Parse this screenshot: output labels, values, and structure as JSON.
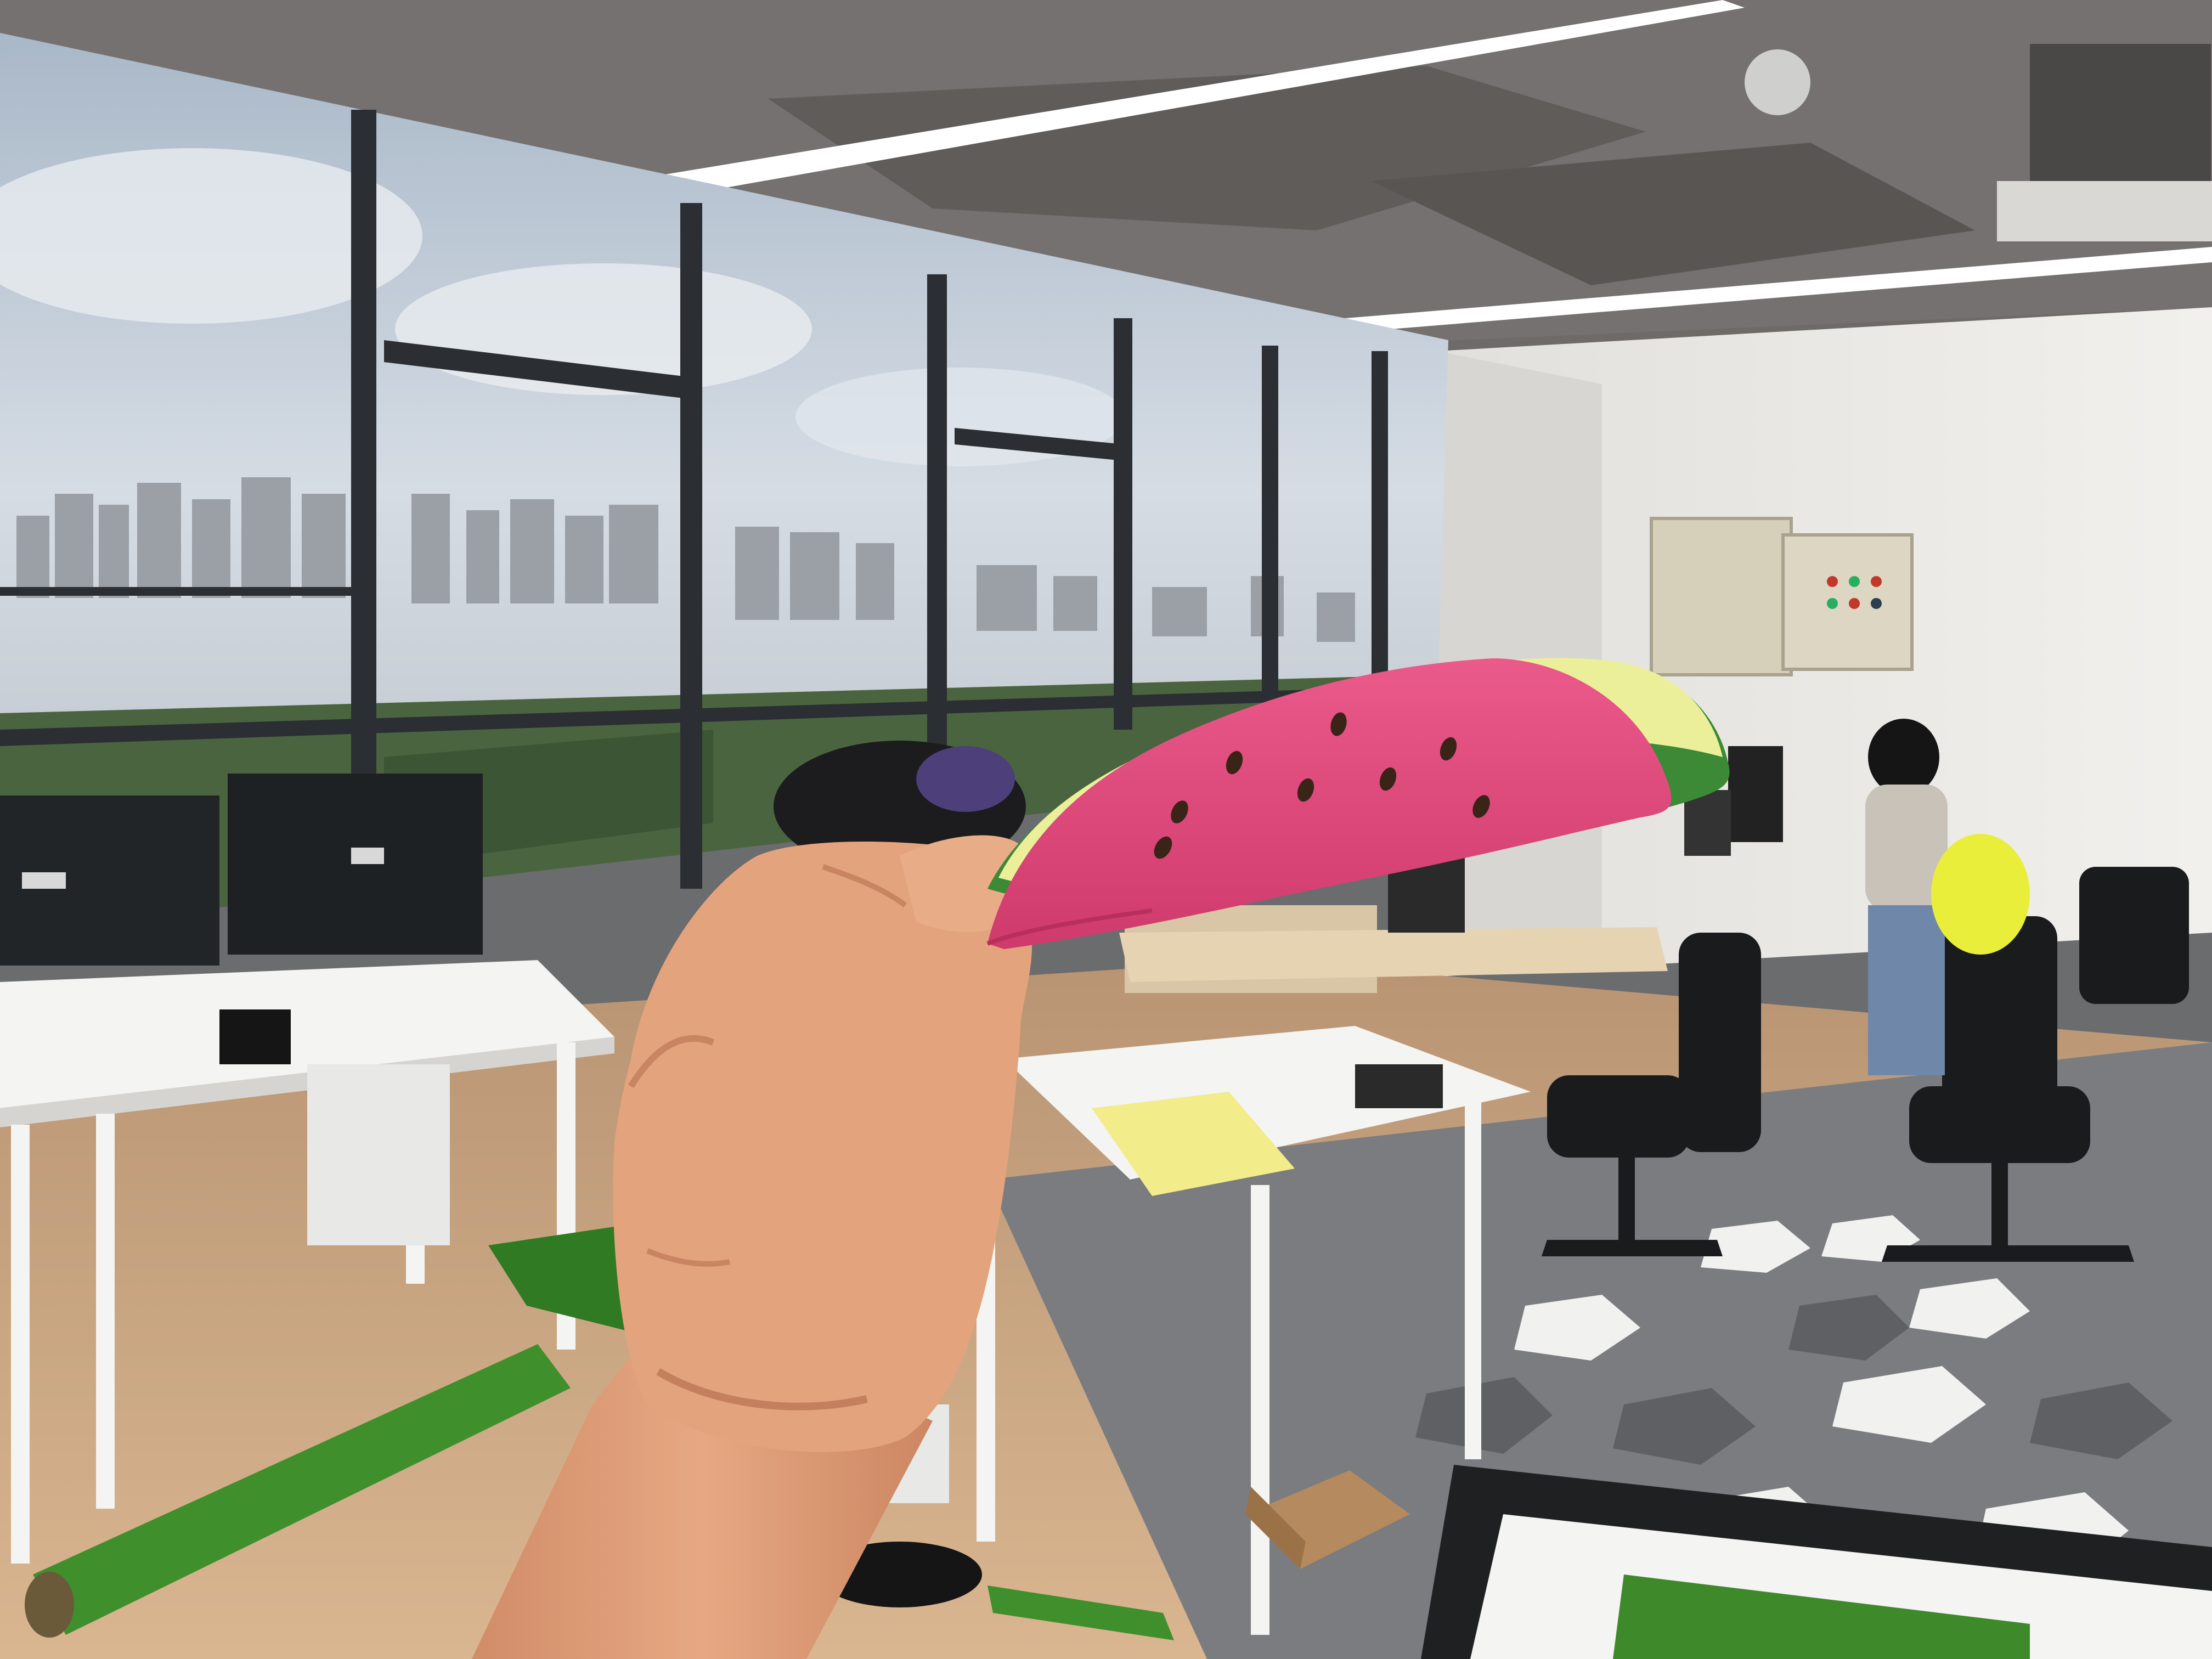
{
  "scene": {
    "subject": "watermelon-slice-plush",
    "colors": {
      "sky": "#c9d3de",
      "sky_cloud": "#e9edf1",
      "city": "#9ea3a8",
      "trees": "#3f5a3a",
      "ceiling": "#6a6766",
      "wall": "#ecebe8",
      "floor_wood": "#c7a27d",
      "hex_white": "#f1f1f0",
      "hex_grey": "#8e8f91",
      "hex_dark": "#5f6063",
      "frame": "#2c3034",
      "desk": "#f4f4f2",
      "turf": "#3f8f2c",
      "skin": "#e2a07b",
      "skin_shadow": "#c98462",
      "melon_flesh": "#e0457a",
      "melon_rind_light": "#ecef9a",
      "melon_rind_green": "#3c8a35",
      "seed": "#3a2418",
      "light_strip": "#ffffff",
      "cabinet": "#dcd6c2"
    }
  }
}
